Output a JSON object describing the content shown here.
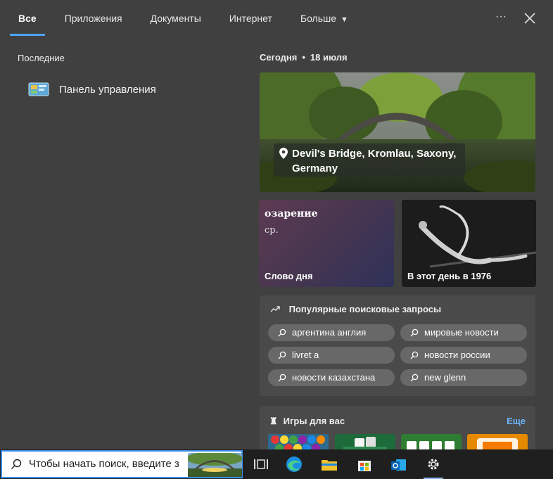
{
  "tabs": [
    {
      "label": "Все"
    },
    {
      "label": "Приложения"
    },
    {
      "label": "Документы"
    },
    {
      "label": "Интернет"
    },
    {
      "label": "Больше"
    }
  ],
  "tabs_more_dots": "···",
  "left": {
    "title": "Последние",
    "recent": [
      {
        "label": "Панель управления",
        "icon": "control-panel-icon"
      }
    ]
  },
  "right": {
    "date_prefix": "Сегодня",
    "date_sep": "•",
    "date": "18 июля",
    "hero": {
      "caption": "Devil's Bridge, Kromlau, Saxony, Germany",
      "icon": "location-pin-icon"
    },
    "word_of_day": {
      "word": "озарение",
      "grammar": "ср.",
      "label": "Слово дня"
    },
    "this_day": {
      "label": "В этот день в 1976"
    },
    "trending": {
      "title": "Популярные поисковые запросы",
      "items": [
        {
          "label": "аргентина англия"
        },
        {
          "label": "мировые новости"
        },
        {
          "label": "livret a"
        },
        {
          "label": "новости россии"
        },
        {
          "label": "новости казахстана"
        },
        {
          "label": "new glenn"
        }
      ]
    },
    "games": {
      "title": "Игры для вас",
      "more": "Еще"
    }
  },
  "taskbar": {
    "search_placeholder": "Чтобы начать поиск, введите з",
    "icons": [
      "task-view-icon",
      "edge-icon",
      "file-explorer-icon",
      "store-icon",
      "outlook-icon",
      "settings-icon"
    ]
  },
  "colors": {
    "accent": "#4da3ff",
    "link": "#6cb4ff",
    "panel": "#4a4a4a",
    "background": "#404040",
    "taskbar": "#1f1f1f"
  }
}
